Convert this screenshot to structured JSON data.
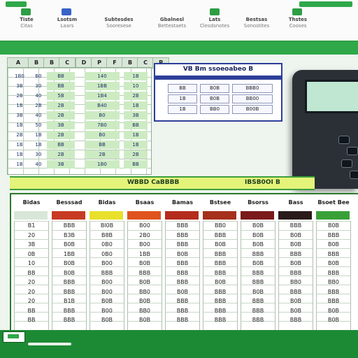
{
  "ribbon": {
    "groups": [
      {
        "label": "Tiste",
        "sub": "Citas"
      },
      {
        "label": "Lsotsm",
        "sub": "Laars"
      },
      {
        "label": "Subtesdes",
        "sub": "Sooresese"
      },
      {
        "label": "Gbalnesl",
        "sub": "Bettestaets"
      },
      {
        "label": "Lats",
        "sub": "Clesdsnotes"
      },
      {
        "label": "Bestsas",
        "sub": "Sonostites"
      },
      {
        "label": "Thstes",
        "sub": "Cooses"
      }
    ]
  },
  "colors": {
    "accent": "#2fa84a",
    "header_blue": "#2c3f9a",
    "band_yellow": "#e4f47a",
    "dark": "#2a3036"
  },
  "sheet": {
    "column_headers": [
      "A",
      "B",
      "B",
      "C",
      "D",
      "P",
      "F",
      "B",
      "C",
      "P"
    ],
    "left_rows": [
      [
        "1B0",
        "B0",
        "BB",
        "140",
        "1B"
      ],
      [
        "3B",
        "30",
        "BB",
        "1BB",
        "10"
      ],
      [
        "2B",
        "40",
        "5B",
        "1B4",
        "2B"
      ],
      [
        "1B",
        "2B",
        "2B",
        "B40",
        "1B"
      ],
      [
        "3B",
        "40",
        "2B",
        "B0",
        "3B"
      ],
      [
        "1B",
        "50",
        "3B",
        "7B0",
        "BB"
      ],
      [
        "2B",
        "1B",
        "2B",
        "B0",
        "1B"
      ],
      [
        "1B",
        "1B",
        "BB",
        "BB",
        "1B"
      ],
      [
        "1B",
        "30",
        "2B",
        "2B",
        "2B"
      ],
      [
        "1B",
        "40",
        "3B",
        "1B0",
        "BB"
      ]
    ]
  },
  "inset": {
    "title": "VB Bm ssoeoabeo B",
    "rows": [
      [
        "BB",
        "B0B",
        "BBB0"
      ],
      [
        "1B",
        "B0B",
        "BB00"
      ],
      [
        "1B",
        "BB0",
        "B00B"
      ]
    ]
  },
  "band": {
    "left": "WBBD CaBBBB",
    "right": "IBSB0OI B"
  },
  "bigtable": {
    "headers": [
      "Bidas",
      "Besssad",
      "Bidas",
      "Bsaas",
      "Bamas",
      "Bstsee",
      "Bsorss",
      "Bass",
      "Bsoet Bee"
    ],
    "strip_colors": [
      "#d8e6d8",
      "#c83a22",
      "#e8e02a",
      "#e0531f",
      "#b42c1c",
      "#a5301c",
      "#7a1a1a",
      "#2a1a1a",
      "#39a038"
    ],
    "columns": [
      [
        "B1",
        "20",
        "3B",
        "0B",
        "10",
        "BB",
        "20",
        "20",
        "20",
        "BB",
        "BB"
      ],
      [
        "BBB",
        "B3B",
        "B0B",
        "1BB",
        "B0B",
        "B0B",
        "BBB",
        "BBB",
        "B1B",
        "BBB",
        "BBB"
      ],
      [
        "Bl0B",
        "B8B",
        "0B0",
        "0B0",
        "B00",
        "BBB",
        "B00",
        "B00",
        "B0B",
        "B00",
        "B0B"
      ],
      [
        "B00",
        "2B0",
        "B00",
        "1BB",
        "B0B",
        "BBB",
        "B0B",
        "BB0",
        "B0B",
        "BB0",
        "B0B"
      ],
      [
        "BBB",
        "BBB",
        "BBB",
        "B0B",
        "BBB",
        "BBB",
        "BBB",
        "B0B",
        "BBB",
        "BBB",
        "BBB"
      ],
      [
        "BB0",
        "BBB",
        "B0B",
        "BBB",
        "BBB",
        "BBB",
        "B0B",
        "BBB",
        "BBB",
        "BBB",
        "BBB"
      ],
      [
        "B0B",
        "B0B",
        "B0B",
        "BBB",
        "B0B",
        "BBB",
        "BBB",
        "B0B",
        "BBB",
        "BBB",
        "BBB"
      ],
      [
        "BBB",
        "B0B",
        "B0B",
        "BBB",
        "B0B",
        "BBB",
        "BB0",
        "BBB",
        "B0B",
        "B0B",
        "BBB"
      ],
      [
        "B0B",
        "BBB",
        "B0B",
        "BBB",
        "B0B",
        "BBB",
        "BB0",
        "BBB",
        "BBB",
        "B0B",
        "B0B"
      ]
    ]
  },
  "footer": {
    "tab_label": ""
  }
}
